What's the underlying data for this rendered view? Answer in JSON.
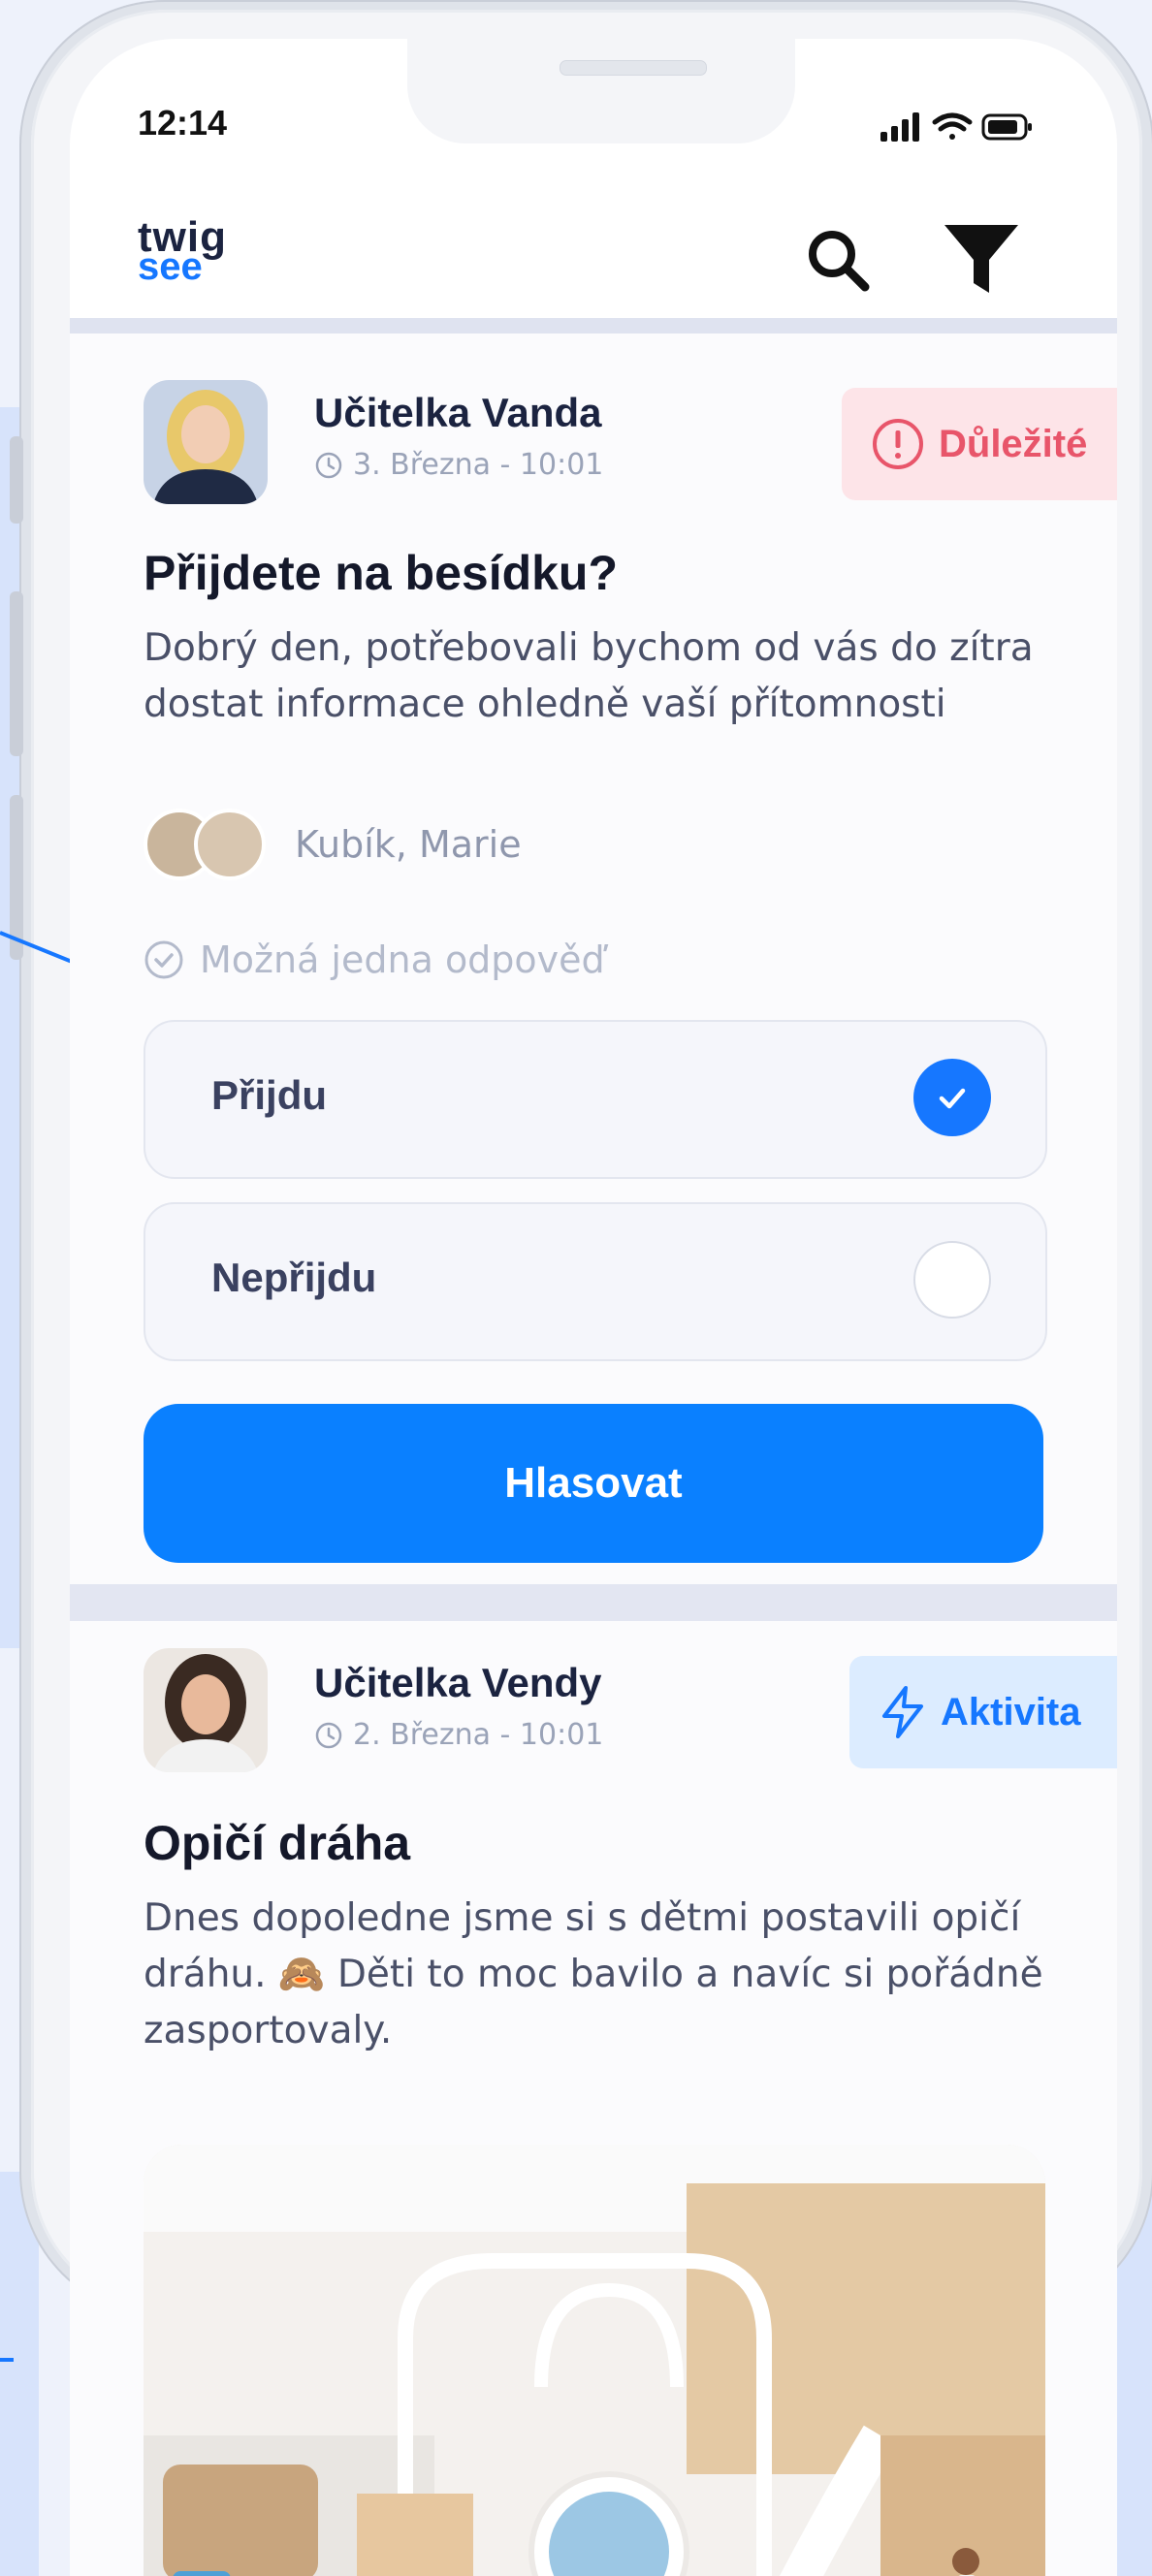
{
  "status_bar": {
    "time": "12:14"
  },
  "app": {
    "logo_line1": "twig",
    "logo_line2": "see"
  },
  "posts": [
    {
      "author": "Učitelka Vanda",
      "timestamp": "3. Března - 10:01",
      "badge": {
        "label": "Důležité",
        "icon": "alert-circle-icon",
        "color": "#e8556a",
        "bg": "#fde4e8"
      },
      "title": "Přijdete na besídku?",
      "body": "Dobrý den, potřebovali bychom od vás do zítra dostat informace ohledně vaší přítomnosti",
      "children": "Kubík, Marie",
      "poll_hint": "Možná jedna odpověď",
      "options": [
        {
          "label": "Přijdu",
          "selected": true
        },
        {
          "label": "Nepřijdu",
          "selected": false
        }
      ],
      "vote_label": "Hlasovat"
    },
    {
      "author": "Učitelka Vendy",
      "timestamp": "2. Března - 10:01",
      "badge": {
        "label": "Aktivita",
        "icon": "lightning-icon",
        "color": "#1677ff",
        "bg": "#dcecff"
      },
      "title": "Opičí dráha",
      "body": "Dnes dopoledne jsme si s dětmi postavili opičí dráhu. 🙈 Děti to moc bavilo a navíc si pořádně zasportovaly."
    }
  ],
  "colors": {
    "accent": "#1677ff",
    "button": "#0a80ff"
  }
}
